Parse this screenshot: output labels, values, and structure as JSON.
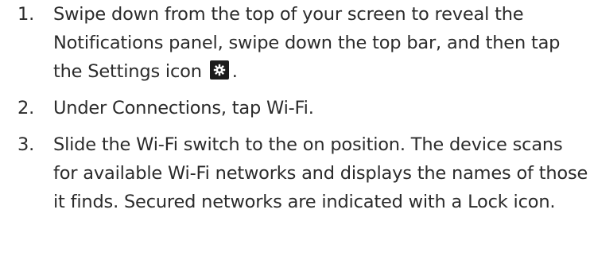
{
  "steps": [
    {
      "number": "1.",
      "text_before_icon": "Swipe down from the top of your screen to reveal the Notifications panel, swipe down the top bar, and then tap the Settings icon",
      "icon": "settings-gear-icon",
      "text_after_icon": "."
    },
    {
      "number": "2.",
      "text": "Under Connections, tap Wi-Fi."
    },
    {
      "number": "3.",
      "text": "Slide the Wi-Fi switch to the on position. The device scans for available Wi-Fi networks and displays the names of those it finds. Secured networks are indicated with a Lock icon."
    }
  ]
}
